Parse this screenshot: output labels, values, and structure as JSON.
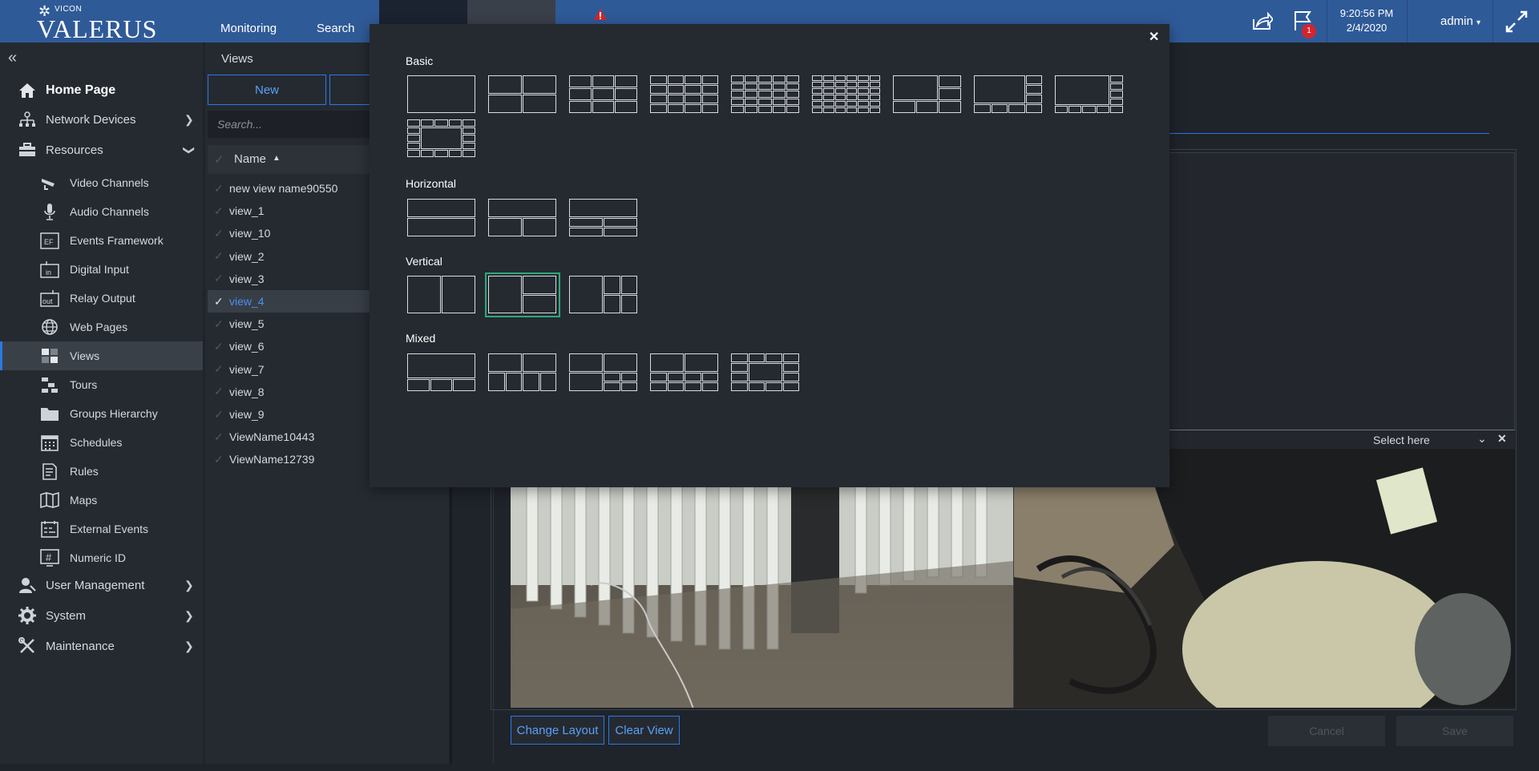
{
  "header": {
    "brand_small": "VICON",
    "brand_name": "VALERUS",
    "nav": [
      "Monitoring",
      "Search"
    ],
    "clock_time": "9:20:56 PM",
    "clock_date": "2/4/2020",
    "user": "admin",
    "notifications_count": "1",
    "icons": [
      "share-icon",
      "flag-icon",
      "alert-icon",
      "fullscreen-icon"
    ]
  },
  "sidebar": {
    "home": "Home Page",
    "items": [
      {
        "label": "Network Devices",
        "icon": "network-icon"
      },
      {
        "label": "Resources",
        "icon": "toolbox-icon"
      },
      {
        "label": "Video Channels",
        "icon": "camera-icon"
      },
      {
        "label": "Audio Channels",
        "icon": "microphone-icon"
      },
      {
        "label": "Events Framework",
        "icon": "events-icon"
      },
      {
        "label": "Digital Input",
        "icon": "digital-input-icon"
      },
      {
        "label": "Relay Output",
        "icon": "relay-output-icon"
      },
      {
        "label": "Web Pages",
        "icon": "globe-icon"
      },
      {
        "label": "Views",
        "icon": "views-icon"
      },
      {
        "label": "Tours",
        "icon": "tours-icon"
      },
      {
        "label": "Groups Hierarchy",
        "icon": "folder-icon"
      },
      {
        "label": "Schedules",
        "icon": "calendar-icon"
      },
      {
        "label": "Rules",
        "icon": "rules-icon"
      },
      {
        "label": "Maps",
        "icon": "map-icon"
      },
      {
        "label": "External Events",
        "icon": "external-events-icon"
      },
      {
        "label": "Numeric ID",
        "icon": "hash-icon"
      },
      {
        "label": "User Management",
        "icon": "user-icon"
      },
      {
        "label": "System",
        "icon": "gear-icon"
      },
      {
        "label": "Maintenance",
        "icon": "tools-icon"
      }
    ]
  },
  "views_panel": {
    "title": "Views",
    "new_button": "New",
    "search_placeholder": "Search...",
    "column_name": "Name",
    "rows": [
      "new view name90550",
      "view_1",
      "view_10",
      "view_2",
      "view_3",
      "view_4",
      "view_5",
      "view_6",
      "view_7",
      "view_8",
      "view_9",
      "ViewName10443",
      "ViewName12739"
    ],
    "selected_row": "view_4"
  },
  "editor": {
    "select_here": "Select here",
    "change_layout": "Change Layout",
    "clear_view": "Clear View",
    "cancel": "Cancel",
    "save": "Save"
  },
  "layout_modal": {
    "sections": [
      "Basic",
      "Horizontal",
      "Vertical",
      "Mixed"
    ],
    "selected": "vertical-2"
  }
}
